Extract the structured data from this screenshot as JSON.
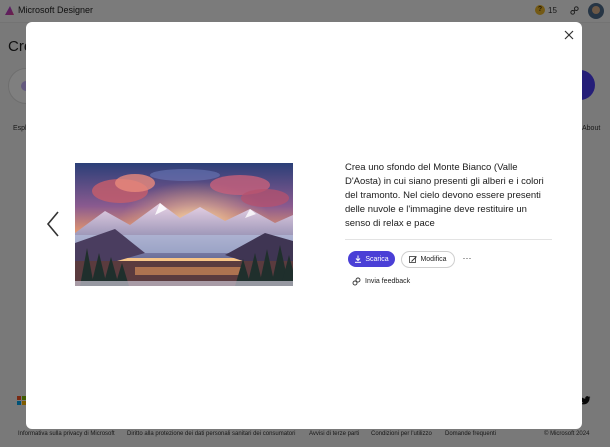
{
  "app": {
    "title": "Microsoft Designer",
    "credits": "15"
  },
  "background": {
    "heading": "Cre",
    "left_text": "Espl",
    "right_text": "About"
  },
  "footer": {
    "links": [
      "Informativa sulla privacy di Microsoft",
      "Diritto alla protezione dei dati personali sanitari dei consumatori",
      "Avvisi di terze parti",
      "Condizioni per l'utilizzo",
      "Domande frequenti"
    ],
    "copyright": "© Microsoft 2024"
  },
  "modal": {
    "prompt": "Crea uno sfondo del Monte Bianco (Valle D'Aosta) in cui siano presenti gli alberi e i colori del tramonto. Nel cielo devono essere presenti delle nuvole e l'immagine deve restituire un senso di relax e pace",
    "download_label": "Scarica",
    "edit_label": "Modifica",
    "more_label": "···",
    "feedback_label": "Invia feedback"
  },
  "colors": {
    "accent": "#4a3fd6",
    "coin": "#e8b52a"
  }
}
